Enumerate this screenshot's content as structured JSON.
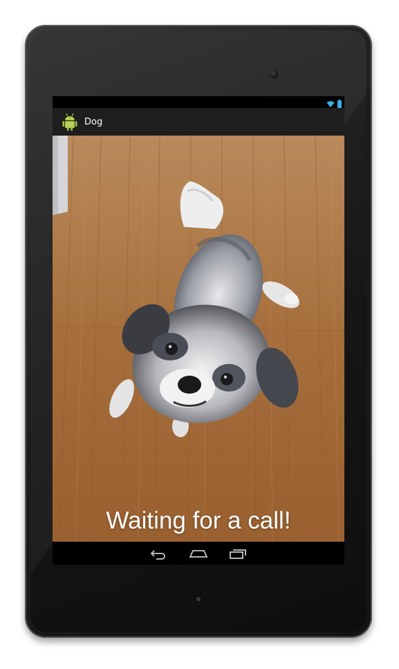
{
  "app": {
    "title": "Dog",
    "icon": "android-robot-icon"
  },
  "status_bar": {
    "icons": [
      "wifi-icon",
      "battery-icon"
    ]
  },
  "main": {
    "caption": "Waiting for a call!",
    "photo": "shih-tzu-dog-on-wooden-floor"
  },
  "nav_bar": {
    "buttons": [
      "back-icon",
      "home-icon",
      "recents-icon"
    ]
  },
  "colors": {
    "action_bar": "#1e1e1e",
    "status_accent": "#33b5e5",
    "android_green": "#a4c639",
    "floor": "#a6713e"
  }
}
